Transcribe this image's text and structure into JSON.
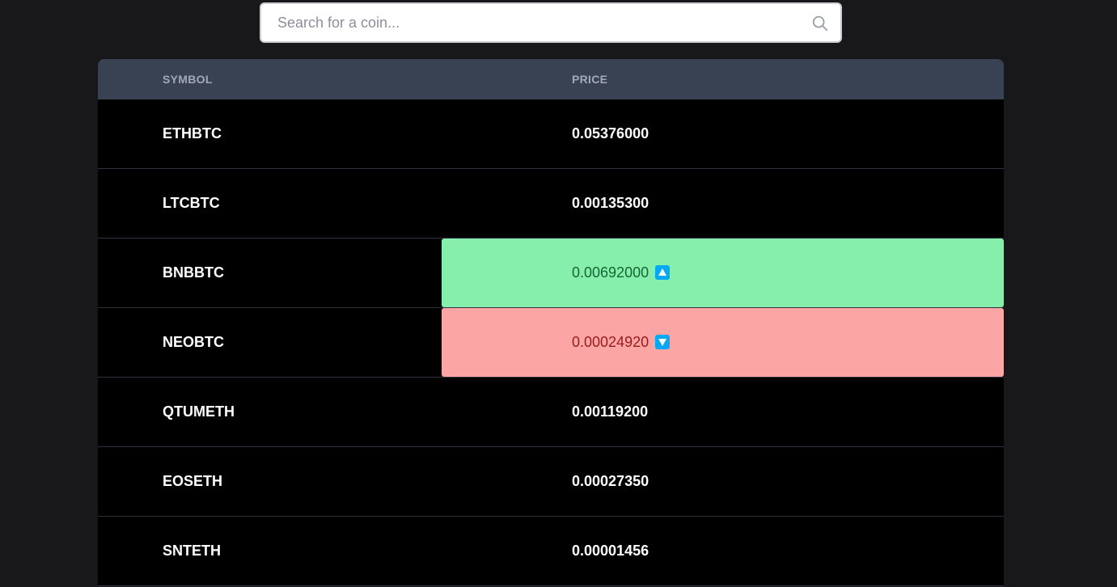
{
  "search": {
    "placeholder": "Search for a coin...",
    "value": "",
    "icon": "search-icon"
  },
  "table": {
    "columns": {
      "symbol": "SYMBOL",
      "price": "PRICE"
    },
    "rows": [
      {
        "symbol": "ETHBTC",
        "price": "0.05376000",
        "change": "none"
      },
      {
        "symbol": "LTCBTC",
        "price": "0.00135300",
        "change": "none"
      },
      {
        "symbol": "BNBBTC",
        "price": "0.00692000",
        "change": "up"
      },
      {
        "symbol": "NEOBTC",
        "price": "0.00024920",
        "change": "down"
      },
      {
        "symbol": "QTUMETH",
        "price": "0.00119200",
        "change": "none"
      },
      {
        "symbol": "EOSETH",
        "price": "0.00027350",
        "change": "none"
      },
      {
        "symbol": "SNTETH",
        "price": "0.00001456",
        "change": "none"
      }
    ]
  },
  "colors": {
    "page_background": "#18181a",
    "header_background": "#394253",
    "row_background": "#000000",
    "up_background": "#86efac",
    "up_text": "#166534",
    "down_background": "#fca5a5",
    "down_text": "#991b1b",
    "arrow_badge": "#03a9f4"
  }
}
